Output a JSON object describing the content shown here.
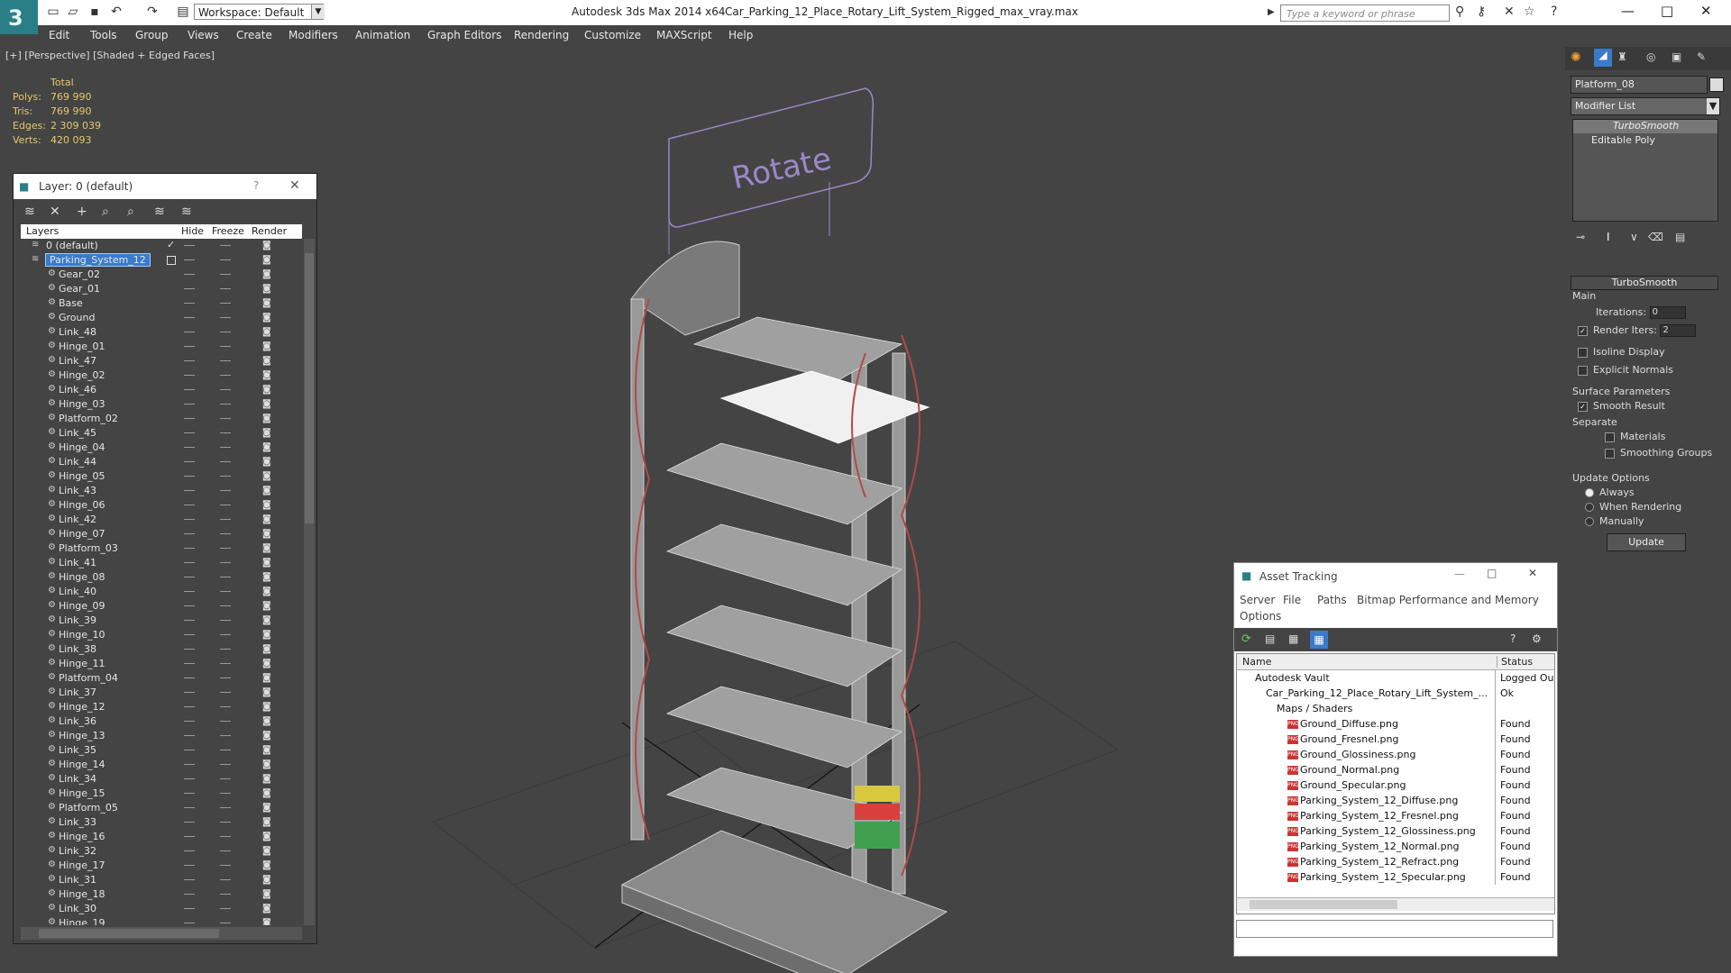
{
  "app": {
    "title": "Autodesk 3ds Max  2014 x64",
    "file": "Car_Parking_12_Place_Rotary_Lift_System_Rigged_max_vray.max",
    "workspace": "Workspace: Default",
    "search_placeholder": "Type a keyword or phrase",
    "logo": "3"
  },
  "menu": [
    "Edit",
    "Tools",
    "Group",
    "Views",
    "Create",
    "Modifiers",
    "Animation",
    "Graph Editors",
    "Rendering",
    "Customize",
    "MAXScript",
    "Help"
  ],
  "viewport": {
    "label": "[+] [Perspective] [Shaded + Edged Faces]",
    "sign_text": "Rotate"
  },
  "stats": {
    "header": "Total",
    "rows": [
      {
        "k": "Polys:",
        "v": "769 990"
      },
      {
        "k": "Tris:",
        "v": "769 990"
      },
      {
        "k": "Edges:",
        "v": "2 309 039"
      },
      {
        "k": "Verts:",
        "v": "420 093"
      }
    ]
  },
  "layer_panel": {
    "title": "Layer: 0 (default)",
    "help": "?",
    "close": "✕",
    "columns": {
      "layers": "Layers",
      "hide": "Hide",
      "freeze": "Freeze",
      "render": "Render"
    },
    "rows": [
      "0 (default)",
      "Parking_System_12",
      "Gear_02",
      "Gear_01",
      "Base",
      "Ground",
      "Link_48",
      "Hinge_01",
      "Link_47",
      "Hinge_02",
      "Link_46",
      "Hinge_03",
      "Platform_02",
      "Link_45",
      "Hinge_04",
      "Link_44",
      "Hinge_05",
      "Link_43",
      "Hinge_06",
      "Link_42",
      "Hinge_07",
      "Platform_03",
      "Link_41",
      "Hinge_08",
      "Link_40",
      "Hinge_09",
      "Link_39",
      "Hinge_10",
      "Link_38",
      "Hinge_11",
      "Platform_04",
      "Link_37",
      "Hinge_12",
      "Link_36",
      "Hinge_13",
      "Link_35",
      "Hinge_14",
      "Link_34",
      "Hinge_15",
      "Platform_05",
      "Link_33",
      "Hinge_16",
      "Link_32",
      "Hinge_17",
      "Link_31",
      "Hinge_18",
      "Link_30",
      "Hinge_19"
    ]
  },
  "asset_tracking": {
    "title": "Asset Tracking",
    "menu": [
      "Server",
      "File",
      "Paths",
      "Bitmap Performance and Memory",
      "Options"
    ],
    "columns": {
      "name": "Name",
      "status": "Status"
    },
    "rows": [
      {
        "name": "Autodesk Vault",
        "status": "Logged Ou",
        "indent": 1
      },
      {
        "name": "Car_Parking_12_Place_Rotary_Lift_System_...",
        "status": "Ok",
        "indent": 2
      },
      {
        "name": "Maps / Shaders",
        "status": "",
        "indent": 3
      },
      {
        "name": "Ground_Diffuse.png",
        "status": "Found",
        "indent": 4
      },
      {
        "name": "Ground_Fresnel.png",
        "status": "Found",
        "indent": 4
      },
      {
        "name": "Ground_Glossiness.png",
        "status": "Found",
        "indent": 4
      },
      {
        "name": "Ground_Normal.png",
        "status": "Found",
        "indent": 4
      },
      {
        "name": "Ground_Specular.png",
        "status": "Found",
        "indent": 4
      },
      {
        "name": "Parking_System_12_Diffuse.png",
        "status": "Found",
        "indent": 4
      },
      {
        "name": "Parking_System_12_Fresnel.png",
        "status": "Found",
        "indent": 4
      },
      {
        "name": "Parking_System_12_Glossiness.png",
        "status": "Found",
        "indent": 4
      },
      {
        "name": "Parking_System_12_Normal.png",
        "status": "Found",
        "indent": 4
      },
      {
        "name": "Parking_System_12_Refract.png",
        "status": "Found",
        "indent": 4
      },
      {
        "name": "Parking_System_12_Specular.png",
        "status": "Found",
        "indent": 4
      }
    ]
  },
  "command_panel": {
    "object_name": "Platform_08",
    "modifier_list": "Modifier List",
    "stack": [
      "TurboSmooth",
      "Editable Poly"
    ],
    "rollout": "TurboSmooth",
    "main": "Main",
    "iterations_label": "Iterations:",
    "iterations": "0",
    "render_iters_label": "Render Iters:",
    "render_iters": "2",
    "isoline": "Isoline Display",
    "explicit": "Explicit Normals",
    "surface": "Surface Parameters",
    "smooth_result": "Smooth Result",
    "separate": "Separate",
    "materials": "Materials",
    "smoothing_groups": "Smoothing Groups",
    "update_options": "Update Options",
    "always": "Always",
    "when_rendering": "When Rendering",
    "manually": "Manually",
    "update": "Update"
  }
}
